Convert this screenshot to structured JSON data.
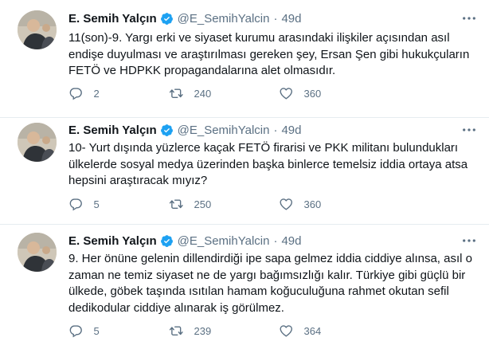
{
  "tweets": [
    {
      "author": "E. Semih Yalçın",
      "handle": "@E_SemihYalcin",
      "separator": "·",
      "time": "49d",
      "lines": [
        "11(son)-9. Yargı erki ve siyaset kurumu arasındaki ilişkiler açısından asıl",
        "endişe duyulması ve araştırılması gereken şey, Ersan Şen gibi hukukçuların",
        "FETÖ ve HDPKK propagandalarına alet olmasıdır."
      ],
      "replies": "2",
      "retweets": "240",
      "likes": "360"
    },
    {
      "author": "E. Semih Yalçın",
      "handle": "@E_SemihYalcin",
      "separator": "·",
      "time": "49d",
      "lines": [
        "10- Yurt dışında yüzlerce kaçak FETÖ firarisi ve PKK militanı bulundukları",
        "ülkelerde sosyal medya üzerinden başka binlerce temelsiz iddia ortaya atsa",
        "hepsini araştıracak mıyız?"
      ],
      "replies": "5",
      "retweets": "250",
      "likes": "360"
    },
    {
      "author": "E. Semih Yalçın",
      "handle": "@E_SemihYalcin",
      "separator": "·",
      "time": "49d",
      "lines": [
        "9. Her önüne gelenin dillendirdiği ipe sapa gelmez iddia ciddiye alınsa, asıl o",
        "zaman ne temiz siyaset ne de yargı bağımsızlığı kalır. Türkiye gibi güçlü bir",
        "ülkede, göbek taşında ısıtılan hamam koğuculuğuna rahmet okutan sefil",
        "dedikodular ciddiye alınarak iş görülmez."
      ],
      "replies": "5",
      "retweets": "239",
      "likes": "364"
    }
  ],
  "icons": {
    "verified": "verified-badge-icon",
    "more": "more-horizontal-icon",
    "reply": "reply-icon",
    "retweet": "retweet-icon",
    "like": "like-heart-icon"
  },
  "colors": {
    "accent": "#1da1f2",
    "secondary_text": "#5b7083",
    "divider": "#e6ecf0"
  }
}
